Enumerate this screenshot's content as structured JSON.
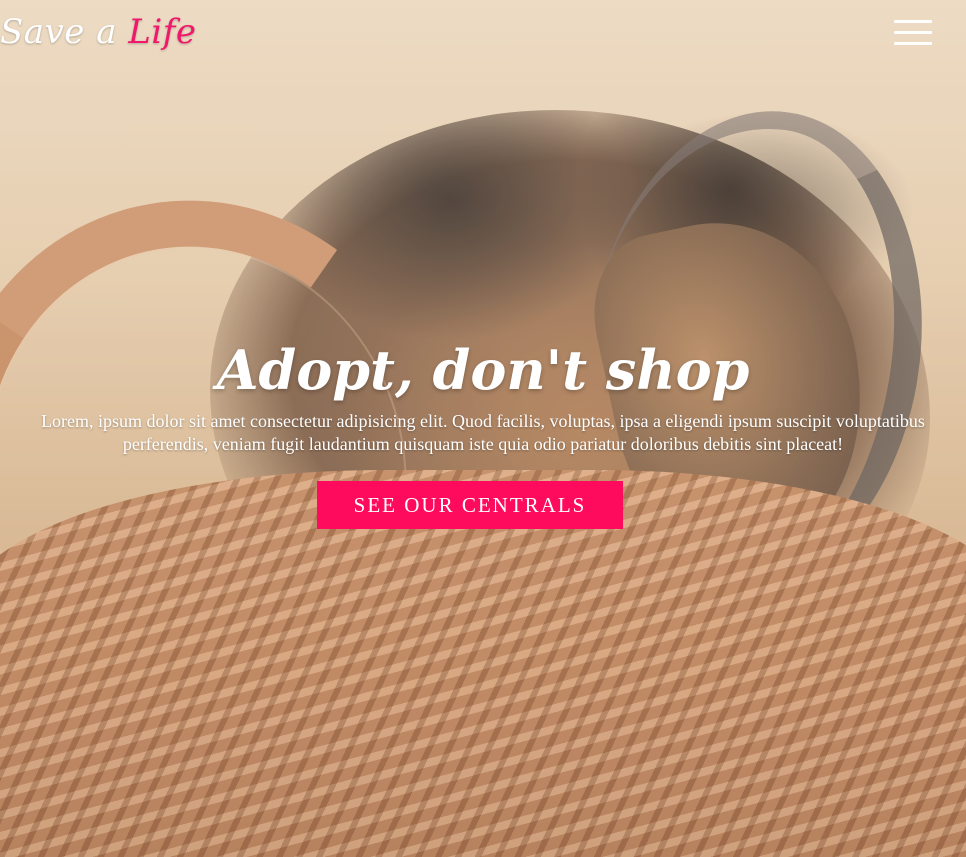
{
  "header": {
    "brand_prefix": "Save a",
    "brand_accent": "Life",
    "menu_icon": "hamburger-menu-icon"
  },
  "hero": {
    "background_image": "sleeping-dog-in-wicker-basket",
    "headline": "Adopt, don't shop",
    "description": "Lorem, ipsum dolor sit amet consectetur adipisicing elit. Quod facilis, voluptas, ipsa a eligendi ipsum suscipit voluptatibus perferendis, veniam fugit laudantium quisquam iste quia odio pariatur doloribus debitis sint placeat!",
    "cta_label": "SEE OUR CENTRALS"
  },
  "colors": {
    "accent": "#ff0b5e",
    "brand_accent": "#f0186a",
    "text": "#ffffff"
  }
}
